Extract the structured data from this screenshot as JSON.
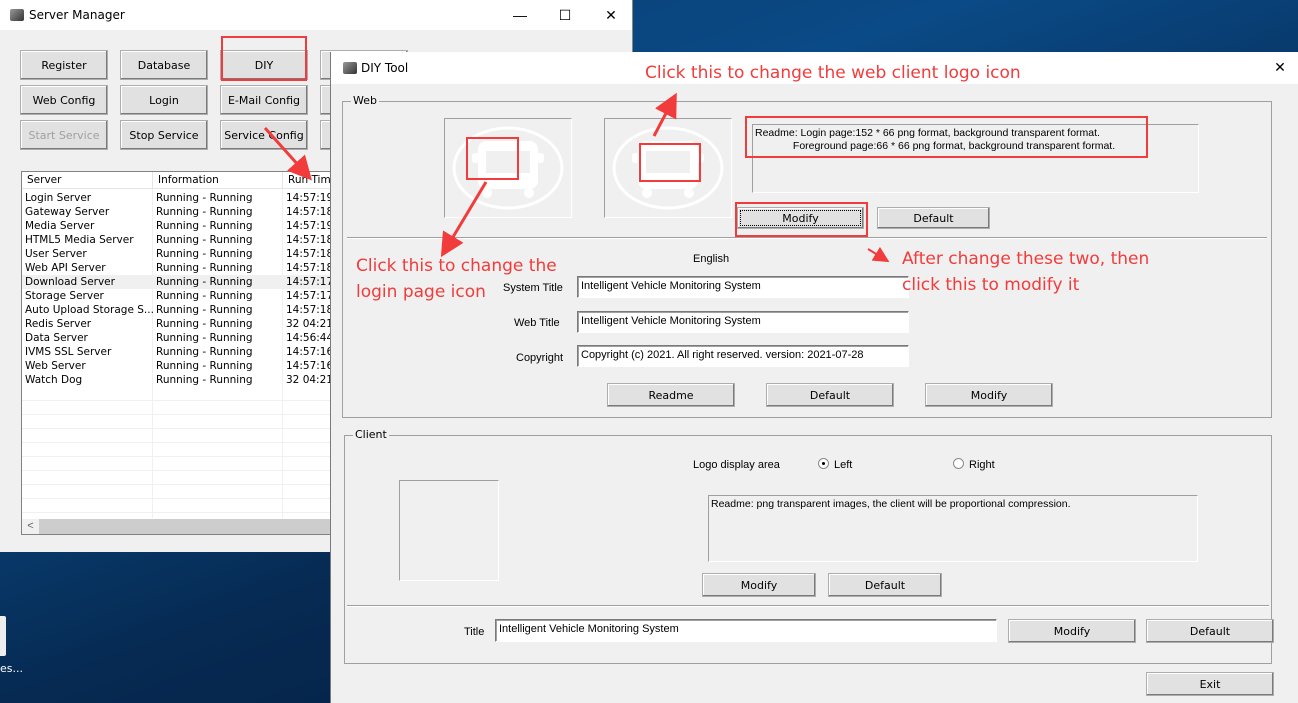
{
  "server_manager": {
    "title": "Server Manager",
    "window_controls": {
      "minimize": "—",
      "maximize": "☐",
      "close": "✕"
    },
    "buttons": [
      {
        "label": "Register",
        "enabled": true
      },
      {
        "label": "Database",
        "enabled": true
      },
      {
        "label": "DIY",
        "enabled": true
      },
      {
        "label": "Web Config",
        "enabled": true
      },
      {
        "label": "Login",
        "enabled": true
      },
      {
        "label": "E-Mail Config",
        "enabled": true
      },
      {
        "label": "Start Service",
        "enabled": false
      },
      {
        "label": "Stop Service",
        "enabled": true
      },
      {
        "label": "Service Config",
        "enabled": true
      }
    ],
    "table": {
      "columns": [
        "Server",
        "Information",
        "Run Time"
      ],
      "rows": [
        {
          "server": "Login Server",
          "information": "Running - Running",
          "run_time": "14:57:19"
        },
        {
          "server": "Gateway Server",
          "information": "Running - Running",
          "run_time": "14:57:18"
        },
        {
          "server": "Media Server",
          "information": "Running - Running",
          "run_time": "14:57:19"
        },
        {
          "server": "HTML5 Media Server",
          "information": "Running - Running",
          "run_time": "14:57:18"
        },
        {
          "server": "User Server",
          "information": "Running - Running",
          "run_time": "14:57:18"
        },
        {
          "server": "Web API Server",
          "information": "Running - Running",
          "run_time": "14:57:18"
        },
        {
          "server": "Download Server",
          "information": "Running - Running",
          "run_time": "14:57:17"
        },
        {
          "server": "Storage Server",
          "information": "Running - Running",
          "run_time": "14:57:17"
        },
        {
          "server": "Auto Upload Storage S...",
          "information": "Running - Running",
          "run_time": "14:57:18"
        },
        {
          "server": "Redis Server",
          "information": "Running - Running",
          "run_time": "32 04:21"
        },
        {
          "server": "Data Server",
          "information": "Running - Running",
          "run_time": "14:56:44"
        },
        {
          "server": "IVMS SSL Server",
          "information": "Running - Running",
          "run_time": "14:57:16"
        },
        {
          "server": "Web Server",
          "information": "Running - Running",
          "run_time": "14:57:16"
        },
        {
          "server": "Watch Dog",
          "information": "Running - Running",
          "run_time": "32 04:21"
        }
      ],
      "selected_row": 6
    },
    "scroll_left": "<"
  },
  "diy_tool": {
    "title": "DIY Tool",
    "close": "✕",
    "web": {
      "group_label": "Web",
      "readme": "Readme: Login page:152 * 66 png format, background transparent format.\n             Foreground page:66 * 66 png format, background transparent format.",
      "logo_modify": "Modify",
      "logo_default": "Default",
      "language": "English",
      "system_title_label": "System Title",
      "system_title_value": "Intelligent Vehicle Monitoring System",
      "web_title_label": "Web Title",
      "web_title_value": "Intelligent Vehicle Monitoring System",
      "copyright_label": "Copyright",
      "copyright_value": "Copyright (c) 2021. All right reserved. version: 2021-07-28",
      "readme_button": "Readme",
      "default_button": "Default",
      "modify_button": "Modify"
    },
    "client": {
      "group_label": "Client",
      "logo_area_label": "Logo display area",
      "radio_left": "Left",
      "radio_right": "Right",
      "selected": "Left",
      "readme": "Readme: png transparent images, the client will be proportional compression.",
      "modify_button": "Modify",
      "default_button": "Default",
      "title_label": "Title",
      "title_value": "Intelligent Vehicle Monitoring System",
      "title_modify": "Modify",
      "title_default": "Default"
    },
    "exit_button": "Exit"
  },
  "annotations": {
    "web_client_logo": "Click this to change the web client logo icon",
    "login_page_icon_line1": "Click this to change the",
    "login_page_icon_line2": "login page icon",
    "modify_hint_line1": "After change these two, then",
    "modify_hint_line2": "click this to modify it",
    "color": "#f23b3b"
  },
  "desktop": {
    "icon_label": "es..."
  }
}
